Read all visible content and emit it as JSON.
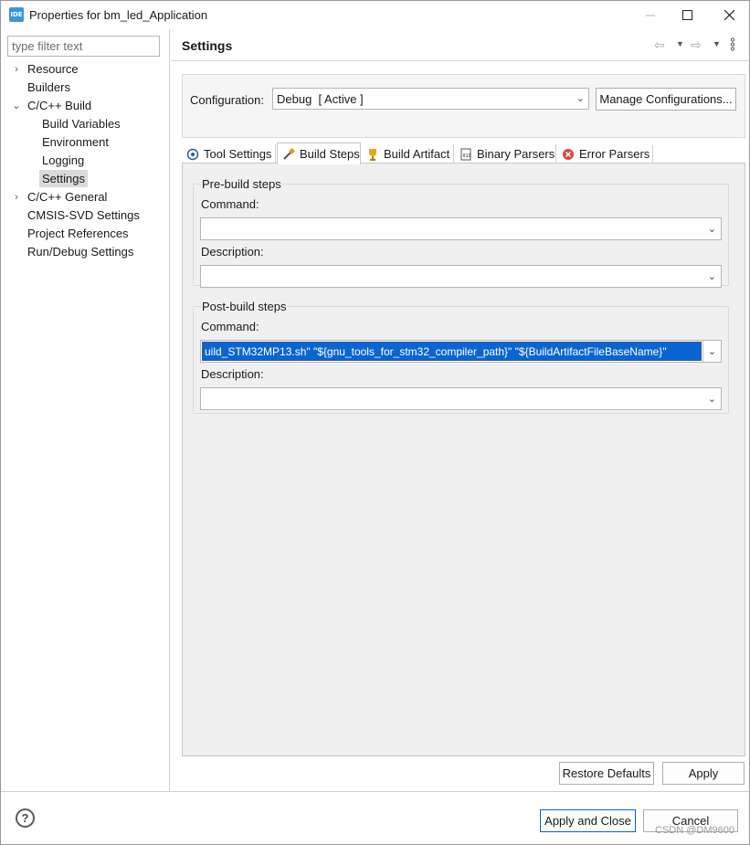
{
  "window": {
    "title": "Properties for bm_led_Application",
    "app_icon": "IDE",
    "controls": [
      "minimize-icon",
      "maximize-icon",
      "close-icon"
    ]
  },
  "left_panel": {
    "filter_placeholder": "type filter text",
    "tree": [
      {
        "label": "Resource",
        "expandable": true,
        "expanded": false
      },
      {
        "label": "Builders",
        "expandable": false
      },
      {
        "label": "C/C++ Build",
        "expandable": true,
        "expanded": true
      },
      {
        "label": "Build Variables",
        "expandable": false
      },
      {
        "label": "Environment",
        "expandable": false
      },
      {
        "label": "Logging",
        "expandable": false
      },
      {
        "label": "Settings",
        "expandable": false,
        "selected": true
      },
      {
        "label": "C/C++ General",
        "expandable": true,
        "expanded": false
      },
      {
        "label": "CMSIS-SVD Settings",
        "expandable": false
      },
      {
        "label": "Project References",
        "expandable": false
      },
      {
        "label": "Run/Debug Settings",
        "expandable": false
      }
    ]
  },
  "right_panel": {
    "title": "Settings",
    "configuration": {
      "label": "Configuration:",
      "value": "Debug  [ Active ]",
      "manage_button": "Manage Configurations..."
    },
    "tabs": [
      {
        "label": "Tool Settings",
        "icon": "tool-settings-icon"
      },
      {
        "label": "Build Steps",
        "icon": "build-steps-icon",
        "active": true
      },
      {
        "label": "Build Artifact",
        "icon": "trophy-icon"
      },
      {
        "label": "Binary Parsers",
        "icon": "binary-icon"
      },
      {
        "label": "Error Parsers",
        "icon": "error-icon"
      }
    ],
    "pre_build": {
      "title": "Pre-build steps",
      "command_label": "Command:",
      "command_value": "",
      "description_label": "Description:",
      "description_value": ""
    },
    "post_build": {
      "title": "Post-build steps",
      "command_label": "Command:",
      "command_value": "uild_STM32MP13.sh\" \"${gnu_tools_for_stm32_compiler_path}\"  \"${BuildArtifactFileBaseName}\"",
      "description_label": "Description:",
      "description_value": ""
    },
    "restore_defaults": "Restore Defaults",
    "apply": "Apply"
  },
  "bottom_bar": {
    "help": "?",
    "apply_and_close": "Apply and Close",
    "cancel": "Cancel"
  },
  "watermark": "CSDN @DM9600",
  "colors": {
    "selection_blue": "#0b64d1",
    "app_icon_blue": "#3a95e0",
    "error_red": "#e0463c"
  }
}
